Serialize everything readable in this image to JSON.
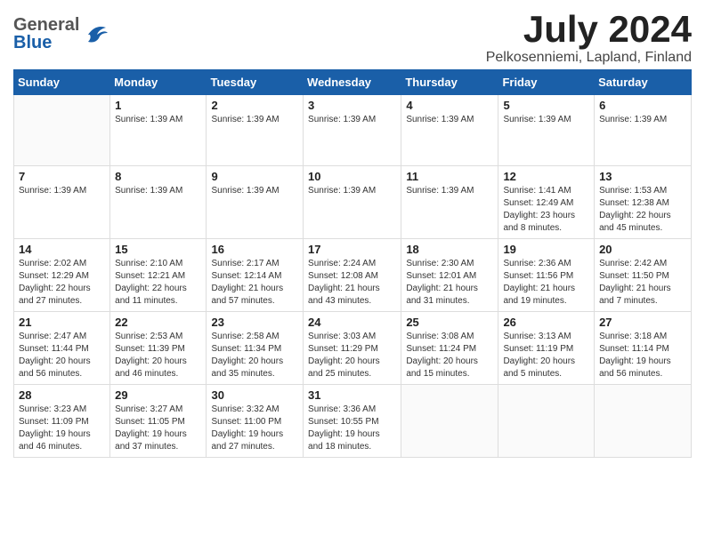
{
  "header": {
    "logo": {
      "general": "General",
      "blue": "Blue"
    },
    "title": "July 2024",
    "location": "Pelkosenniemi, Lapland, Finland"
  },
  "columns": [
    "Sunday",
    "Monday",
    "Tuesday",
    "Wednesday",
    "Thursday",
    "Friday",
    "Saturday"
  ],
  "weeks": [
    [
      {
        "num": "",
        "info": ""
      },
      {
        "num": "1",
        "info": "Sunrise: 1:39 AM"
      },
      {
        "num": "2",
        "info": "Sunrise: 1:39 AM"
      },
      {
        "num": "3",
        "info": "Sunrise: 1:39 AM"
      },
      {
        "num": "4",
        "info": "Sunrise: 1:39 AM"
      },
      {
        "num": "5",
        "info": "Sunrise: 1:39 AM"
      },
      {
        "num": "6",
        "info": "Sunrise: 1:39 AM"
      }
    ],
    [
      {
        "num": "7",
        "info": "Sunrise: 1:39 AM"
      },
      {
        "num": "8",
        "info": "Sunrise: 1:39 AM"
      },
      {
        "num": "9",
        "info": "Sunrise: 1:39 AM"
      },
      {
        "num": "10",
        "info": "Sunrise: 1:39 AM"
      },
      {
        "num": "11",
        "info": "Sunrise: 1:39 AM"
      },
      {
        "num": "12",
        "info": "Sunrise: 1:41 AM\nSunset: 12:49 AM\nDaylight: 23 hours and 8 minutes."
      },
      {
        "num": "13",
        "info": "Sunrise: 1:53 AM\nSunset: 12:38 AM\nDaylight: 22 hours and 45 minutes."
      }
    ],
    [
      {
        "num": "14",
        "info": "Sunrise: 2:02 AM\nSunset: 12:29 AM\nDaylight: 22 hours and 27 minutes."
      },
      {
        "num": "15",
        "info": "Sunrise: 2:10 AM\nSunset: 12:21 AM\nDaylight: 22 hours and 11 minutes."
      },
      {
        "num": "16",
        "info": "Sunrise: 2:17 AM\nSunset: 12:14 AM\nDaylight: 21 hours and 57 minutes."
      },
      {
        "num": "17",
        "info": "Sunrise: 2:24 AM\nSunset: 12:08 AM\nDaylight: 21 hours and 43 minutes."
      },
      {
        "num": "18",
        "info": "Sunrise: 2:30 AM\nSunset: 12:01 AM\nDaylight: 21 hours and 31 minutes."
      },
      {
        "num": "19",
        "info": "Sunrise: 2:36 AM\nSunset: 11:56 PM\nDaylight: 21 hours and 19 minutes."
      },
      {
        "num": "20",
        "info": "Sunrise: 2:42 AM\nSunset: 11:50 PM\nDaylight: 21 hours and 7 minutes."
      }
    ],
    [
      {
        "num": "21",
        "info": "Sunrise: 2:47 AM\nSunset: 11:44 PM\nDaylight: 20 hours and 56 minutes."
      },
      {
        "num": "22",
        "info": "Sunrise: 2:53 AM\nSunset: 11:39 PM\nDaylight: 20 hours and 46 minutes."
      },
      {
        "num": "23",
        "info": "Sunrise: 2:58 AM\nSunset: 11:34 PM\nDaylight: 20 hours and 35 minutes."
      },
      {
        "num": "24",
        "info": "Sunrise: 3:03 AM\nSunset: 11:29 PM\nDaylight: 20 hours and 25 minutes."
      },
      {
        "num": "25",
        "info": "Sunrise: 3:08 AM\nSunset: 11:24 PM\nDaylight: 20 hours and 15 minutes."
      },
      {
        "num": "26",
        "info": "Sunrise: 3:13 AM\nSunset: 11:19 PM\nDaylight: 20 hours and 5 minutes."
      },
      {
        "num": "27",
        "info": "Sunrise: 3:18 AM\nSunset: 11:14 PM\nDaylight: 19 hours and 56 minutes."
      }
    ],
    [
      {
        "num": "28",
        "info": "Sunrise: 3:23 AM\nSunset: 11:09 PM\nDaylight: 19 hours and 46 minutes."
      },
      {
        "num": "29",
        "info": "Sunrise: 3:27 AM\nSunset: 11:05 PM\nDaylight: 19 hours and 37 minutes."
      },
      {
        "num": "30",
        "info": "Sunrise: 3:32 AM\nSunset: 11:00 PM\nDaylight: 19 hours and 27 minutes."
      },
      {
        "num": "31",
        "info": "Sunrise: 3:36 AM\nSunset: 10:55 PM\nDaylight: 19 hours and 18 minutes."
      },
      {
        "num": "",
        "info": ""
      },
      {
        "num": "",
        "info": ""
      },
      {
        "num": "",
        "info": ""
      }
    ]
  ]
}
